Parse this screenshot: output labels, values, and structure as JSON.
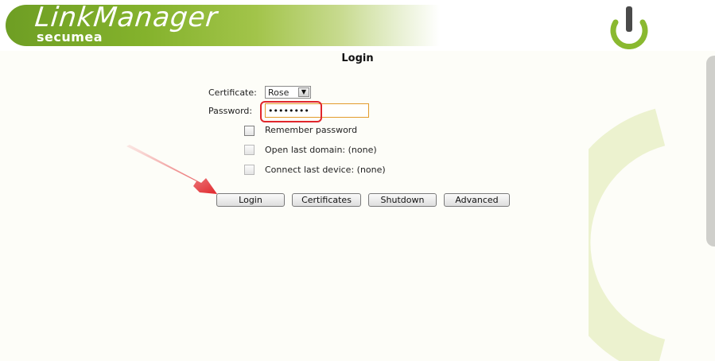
{
  "header": {
    "brand_name": "LinkManager",
    "brand_sub": "secumea",
    "accent_color": "#84b22c"
  },
  "login": {
    "title": "Login",
    "certificate_label": "Certificate:",
    "certificate_value": "Rose",
    "password_label": "Password:",
    "password_value": "••••••••",
    "remember_password_label": "Remember password",
    "open_last_domain_label": "Open last domain: (none)",
    "connect_last_device_label": "Connect last device: (none)"
  },
  "buttons": {
    "login": "Login",
    "certificates": "Certificates",
    "shutdown": "Shutdown",
    "advanced": "Advanced"
  },
  "annotation": {
    "highlight_color": "#e0262b"
  }
}
